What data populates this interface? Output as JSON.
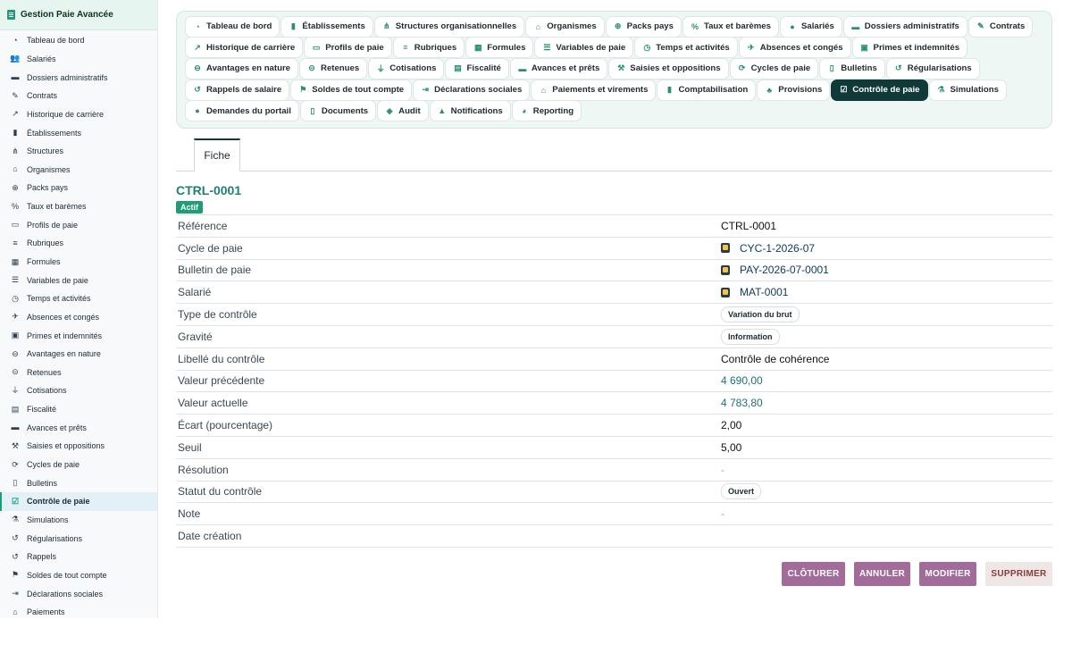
{
  "app": {
    "title": "Gestion Paie Avancée"
  },
  "sidebar": {
    "items": [
      {
        "label": "Tableau de bord",
        "icon": "dashboard-icon",
        "glyph": "◔"
      },
      {
        "label": "Salariés",
        "icon": "users-icon",
        "glyph": "👥"
      },
      {
        "label": "Dossiers administratifs",
        "icon": "folder-icon",
        "glyph": "▬"
      },
      {
        "label": "Contrats",
        "icon": "contract-icon",
        "glyph": "✎"
      },
      {
        "label": "Historique de carrière",
        "icon": "chart-line-icon",
        "glyph": "↗"
      },
      {
        "label": "Établissements",
        "icon": "building-icon",
        "glyph": "▮"
      },
      {
        "label": "Structures",
        "icon": "sitemap-icon",
        "glyph": "⋔"
      },
      {
        "label": "Organismes",
        "icon": "institution-icon",
        "glyph": "⌂"
      },
      {
        "label": "Packs pays",
        "icon": "globe-icon",
        "glyph": "⊕"
      },
      {
        "label": "Taux et barèmes",
        "icon": "percent-icon",
        "glyph": "%"
      },
      {
        "label": "Profils de paie",
        "icon": "id-card-icon",
        "glyph": "▭"
      },
      {
        "label": "Rubriques",
        "icon": "list-icon",
        "glyph": "≡"
      },
      {
        "label": "Formules",
        "icon": "calculator-icon",
        "glyph": "▦"
      },
      {
        "label": "Variables de paie",
        "icon": "sliders-icon",
        "glyph": "☰"
      },
      {
        "label": "Temps et activités",
        "icon": "clock-icon",
        "glyph": "◷"
      },
      {
        "label": "Absences et congés",
        "icon": "plane-icon",
        "glyph": "✈"
      },
      {
        "label": "Primes et indemnités",
        "icon": "gift-icon",
        "glyph": "▣"
      },
      {
        "label": "Avantages en nature",
        "icon": "car-icon",
        "glyph": "⊖"
      },
      {
        "label": "Retenues",
        "icon": "minus-circle-icon",
        "glyph": "⊝"
      },
      {
        "label": "Cotisations",
        "icon": "hand-coin-icon",
        "glyph": "⏚"
      },
      {
        "label": "Fiscalité",
        "icon": "receipt-icon",
        "glyph": "▤"
      },
      {
        "label": "Avances et prêts",
        "icon": "money-icon",
        "glyph": "▬"
      },
      {
        "label": "Saisies et oppositions",
        "icon": "gavel-icon",
        "glyph": "⚒"
      },
      {
        "label": "Cycles de paie",
        "icon": "sync-icon",
        "glyph": "⟳"
      },
      {
        "label": "Bulletins",
        "icon": "file-icon",
        "glyph": "▯"
      },
      {
        "label": "Contrôle de paie",
        "icon": "clipboard-check-icon",
        "glyph": "☑"
      },
      {
        "label": "Simulations",
        "icon": "flask-icon",
        "glyph": "⚗"
      },
      {
        "label": "Régularisations",
        "icon": "undo-icon",
        "glyph": "↺"
      },
      {
        "label": "Rappels",
        "icon": "history-icon",
        "glyph": "↺"
      },
      {
        "label": "Soldes de tout compte",
        "icon": "flag-icon",
        "glyph": "⚑"
      },
      {
        "label": "Déclarations sociales",
        "icon": "file-export-icon",
        "glyph": "⇥"
      },
      {
        "label": "Paiements",
        "icon": "bank-icon",
        "glyph": "⌂"
      }
    ],
    "active_index": 25
  },
  "tabs": {
    "rows": [
      [
        {
          "label": "Tableau de bord",
          "icon": "dashboard-icon",
          "glyph": "◔"
        },
        {
          "label": "Établissements",
          "icon": "building-icon",
          "glyph": "▮"
        },
        {
          "label": "Structures organisationnelles",
          "icon": "sitemap-icon",
          "glyph": "⋔"
        },
        {
          "label": "Organismes",
          "icon": "institution-icon",
          "glyph": "⌂"
        },
        {
          "label": "Packs pays",
          "icon": "globe-icon",
          "glyph": "⊕"
        },
        {
          "label": "Taux et barèmes",
          "icon": "percent-icon",
          "glyph": "%"
        },
        {
          "label": "Salariés",
          "icon": "user-icon",
          "glyph": "●"
        },
        {
          "label": "Dossiers administratifs",
          "icon": "folder-icon",
          "glyph": "▬"
        },
        {
          "label": "Contrats",
          "icon": "contract-icon",
          "glyph": "✎"
        }
      ],
      [
        {
          "label": "Historique de carrière",
          "icon": "chart-line-icon",
          "glyph": "↗"
        },
        {
          "label": "Profils de paie",
          "icon": "id-card-icon",
          "glyph": "▭"
        },
        {
          "label": "Rubriques",
          "icon": "list-icon",
          "glyph": "≡"
        },
        {
          "label": "Formules",
          "icon": "calculator-icon",
          "glyph": "▦"
        },
        {
          "label": "Variables de paie",
          "icon": "sliders-icon",
          "glyph": "☰"
        },
        {
          "label": "Temps et activités",
          "icon": "clock-icon",
          "glyph": "◷"
        },
        {
          "label": "Absences et congés",
          "icon": "plane-icon",
          "glyph": "✈"
        },
        {
          "label": "Primes et indemnités",
          "icon": "gift-icon",
          "glyph": "▣"
        }
      ],
      [
        {
          "label": "Avantages en nature",
          "icon": "car-icon",
          "glyph": "⊖"
        },
        {
          "label": "Retenues",
          "icon": "minus-circle-icon",
          "glyph": "⊝"
        },
        {
          "label": "Cotisations",
          "icon": "hand-coin-icon",
          "glyph": "⏚"
        },
        {
          "label": "Fiscalité",
          "icon": "receipt-icon",
          "glyph": "▤"
        },
        {
          "label": "Avances et prêts",
          "icon": "money-icon",
          "glyph": "▬"
        },
        {
          "label": "Saisies et oppositions",
          "icon": "gavel-icon",
          "glyph": "⚒"
        },
        {
          "label": "Cycles de paie",
          "icon": "sync-icon",
          "glyph": "⟳"
        },
        {
          "label": "Bulletins",
          "icon": "file-icon",
          "glyph": "▯"
        },
        {
          "label": "Régularisations",
          "icon": "undo-icon",
          "glyph": "↺"
        }
      ],
      [
        {
          "label": "Rappels de salaire",
          "icon": "history-icon",
          "glyph": "↺"
        },
        {
          "label": "Soldes de tout compte",
          "icon": "flag-icon",
          "glyph": "⚑"
        },
        {
          "label": "Déclarations sociales",
          "icon": "file-export-icon",
          "glyph": "⇥"
        },
        {
          "label": "Paiements et virements",
          "icon": "bank-icon",
          "glyph": "⌂"
        },
        {
          "label": "Comptabilisation",
          "icon": "book-icon",
          "glyph": "▮"
        },
        {
          "label": "Provisions",
          "icon": "piggy-bank-icon",
          "glyph": "♣"
        },
        {
          "label": "Contrôle de paie",
          "icon": "clipboard-check-icon",
          "glyph": "☑"
        },
        {
          "label": "Simulations",
          "icon": "flask-icon",
          "glyph": "⚗"
        }
      ],
      [
        {
          "label": "Demandes du portail",
          "icon": "comment-icon",
          "glyph": "●"
        },
        {
          "label": "Documents",
          "icon": "document-icon",
          "glyph": "▯"
        },
        {
          "label": "Audit",
          "icon": "shield-icon",
          "glyph": "◈"
        },
        {
          "label": "Notifications",
          "icon": "bell-icon",
          "glyph": "▲"
        },
        {
          "label": "Reporting",
          "icon": "pie-chart-icon",
          "glyph": "◕"
        }
      ]
    ],
    "active_label": "Contrôle de paie"
  },
  "fiche": {
    "tab_label": "Fiche"
  },
  "record": {
    "title": "CTRL-0001",
    "status_badge": "Actif",
    "fields": [
      {
        "label": "Référence",
        "value": "CTRL-0001",
        "kind": "text"
      },
      {
        "label": "Cycle de paie",
        "value": "CYC-1-2026-07",
        "kind": "ref"
      },
      {
        "label": "Bulletin de paie",
        "value": "PAY-2026-07-0001",
        "kind": "ref"
      },
      {
        "label": "Salarié",
        "value": "MAT-0001",
        "kind": "ref"
      },
      {
        "label": "Type de contrôle",
        "value": "Variation du brut",
        "kind": "chip"
      },
      {
        "label": "Gravité",
        "value": "Information",
        "kind": "chip"
      },
      {
        "label": "Libellé du contrôle",
        "value": "Contrôle de cohérence",
        "kind": "text"
      },
      {
        "label": "Valeur précédente",
        "value": "4 690,00",
        "kind": "num"
      },
      {
        "label": "Valeur actuelle",
        "value": "4 783,80",
        "kind": "num"
      },
      {
        "label": "Écart (pourcentage)",
        "value": "2,00",
        "kind": "text"
      },
      {
        "label": "Seuil",
        "value": "5,00",
        "kind": "text"
      },
      {
        "label": "Résolution",
        "value": "-",
        "kind": "dash"
      },
      {
        "label": "Statut du contrôle",
        "value": "Ouvert",
        "kind": "chip"
      },
      {
        "label": "Note",
        "value": "-",
        "kind": "dash"
      },
      {
        "label": "Date création",
        "value": "",
        "kind": "text"
      }
    ]
  },
  "actions": {
    "close_label": "CLÔTURER",
    "cancel_label": "ANNULER",
    "edit_label": "MODIFIER",
    "delete_label": "SUPPRIMER"
  }
}
